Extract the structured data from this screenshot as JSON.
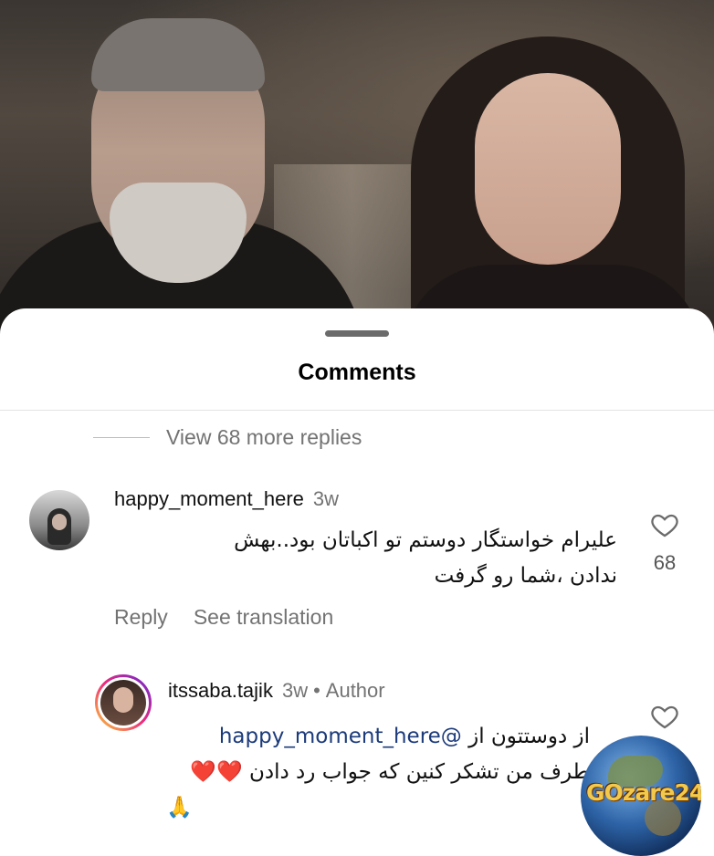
{
  "sheet": {
    "title": "Comments"
  },
  "thread": {
    "view_more_label": "View 68 more replies"
  },
  "comments": [
    {
      "username": "happy_moment_here",
      "time": "3w",
      "text_line1": "علیرام خواستگار دوستم تو اکباتان بود..بهش",
      "text_line2": "ندادن ،شما رو گرفت",
      "likes": "68",
      "reply_label": "Reply",
      "translate_label": "See translation",
      "icon": "heart-icon"
    },
    {
      "username": "itssaba.tajik",
      "time": "3w",
      "separator": "•",
      "badge": "Author",
      "mention": "@happy_moment_here",
      "text_line1_prefix": "از دوستتون از ",
      "text_line2": "طرف من تشکر کنین که جواب رد دادن ❤️❤️",
      "text_line3": "🙏",
      "icon": "heart-icon"
    }
  ],
  "watermark": {
    "text": "GOzare24"
  },
  "colors": {
    "sheet_bg": "#ffffff",
    "secondary_text": "#737373",
    "mention": "#1c3b7a"
  }
}
